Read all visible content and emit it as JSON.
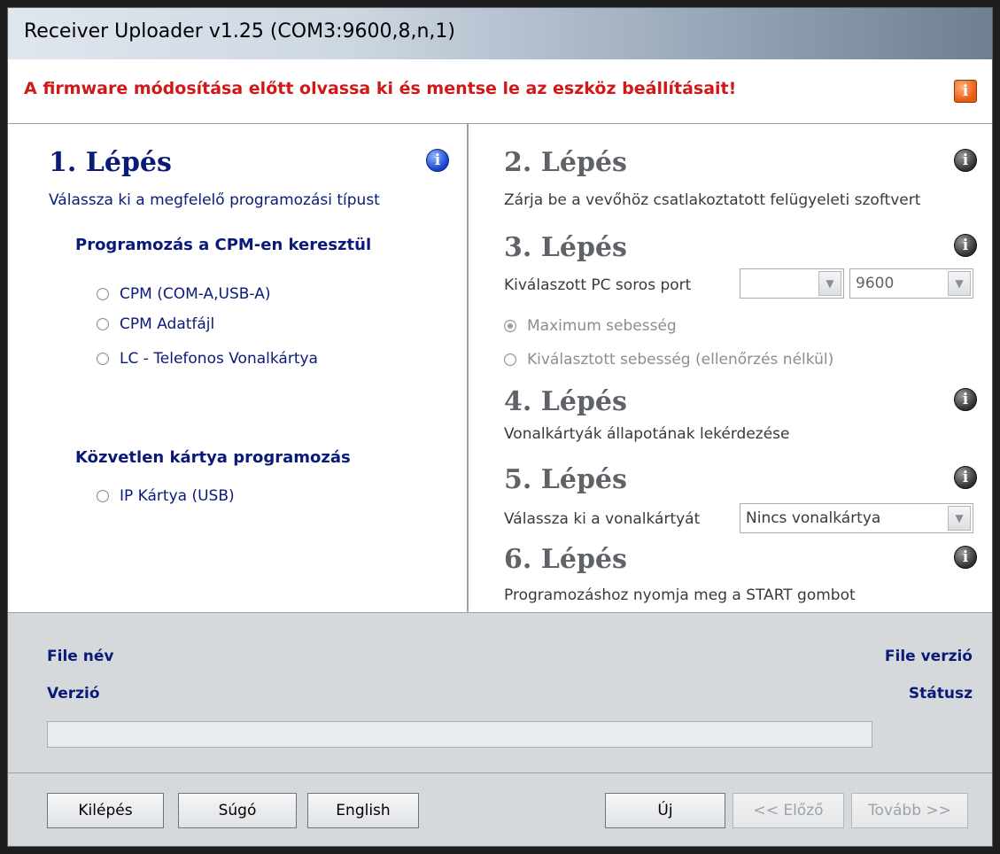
{
  "window": {
    "title": "Receiver Uploader v1.25 (COM3:9600,8,n,1)"
  },
  "warning": {
    "text": "A firmware módosítása előtt olvassa ki és mentse le az eszköz beállításait!"
  },
  "step1": {
    "title": "1. Lépés",
    "desc": "Válassza ki a megfelelő programozási típust",
    "section_cpm": "Programozás a CPM-en keresztül",
    "options_cpm": [
      "CPM (COM-A,USB-A)",
      "CPM Adatfájl",
      "LC - Telefonos Vonalkártya"
    ],
    "section_direct": "Közvetlen kártya programozás",
    "options_direct": [
      "IP Kártya (USB)"
    ]
  },
  "step2": {
    "title": "2. Lépés",
    "desc": "Zárja be a vevőhöz csatlakoztatott felügyeleti szoftvert"
  },
  "step3": {
    "title": "3. Lépés",
    "port_label": "Kiválaszott PC soros port",
    "port_value": "",
    "baud_value": "9600",
    "speed_options": [
      "Maximum sebesség",
      "Kiválasztott sebesség (ellenőrzés nélkül)"
    ]
  },
  "step4": {
    "title": "4. Lépés",
    "desc": "Vonalkártyák állapotának lekérdezése"
  },
  "step5": {
    "title": "5. Lépés",
    "label": "Válassza ki a vonalkártyát",
    "card_value": "Nincs vonalkártya"
  },
  "step6": {
    "title": "6. Lépés",
    "desc": "Programozáshoz nyomja meg a START gombot"
  },
  "info": {
    "file_name": "File név",
    "file_version": "File verzió",
    "version": "Verzió",
    "status": "Státusz",
    "progress": 0
  },
  "buttons": {
    "exit": "Kilépés",
    "help": "Súgó",
    "english": "English",
    "new": "Új",
    "prev": "<< Előző",
    "next": "Tovább >>"
  }
}
